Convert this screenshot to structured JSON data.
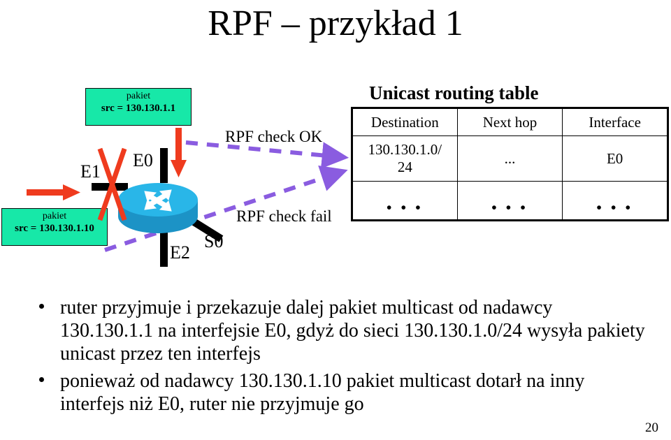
{
  "slide": {
    "title": "RPF – przykład 1",
    "page_number": "20"
  },
  "diagram": {
    "packet_top": {
      "label": "pakiet",
      "src": "src = 130.130.1.1"
    },
    "packet_bottom": {
      "label": "pakiet",
      "src": "src = 130.130.1.10"
    },
    "interfaces": {
      "e0": "E0",
      "e1": "E1",
      "e2": "E2",
      "s0": "S0"
    },
    "annotations": {
      "rpf_ok": "RPF check OK",
      "rpf_fail": "RPF check fail"
    },
    "colors": {
      "packet_box": "#17E8A8",
      "router_body": "#189FD4",
      "router_top": "#29B6E8",
      "red_arrow": "#EF3B1E",
      "rpf_dash": "#8A5CE0"
    }
  },
  "routing_table": {
    "title": "Unicast routing table",
    "columns": [
      "Destination",
      "Next hop",
      "Interface"
    ],
    "rows": [
      [
        "130.130.1.0/\n24",
        "...",
        "E0"
      ],
      [
        "• • •",
        "• • •",
        "• • •"
      ]
    ],
    "row1": {
      "destination_line1": "130.130.1.0/",
      "destination_line2": "24",
      "next_hop": "...",
      "interface": "E0"
    },
    "row2": {
      "destination": "• • •",
      "next_hop": "• • •",
      "interface": "• • •"
    }
  },
  "body": {
    "bullets": [
      "ruter przyjmuje i przekazuje dalej pakiet multicast od nadawcy 130.130.1.1 na interfejsie E0, gdyż do sieci 130.130.1.0/24 wysyła pakiety unicast przez ten interfejs",
      "ponieważ od nadawcy 130.130.1.10 pakiet multicast dotarł na inny interfejs niż E0, ruter nie przyjmuje go"
    ]
  }
}
